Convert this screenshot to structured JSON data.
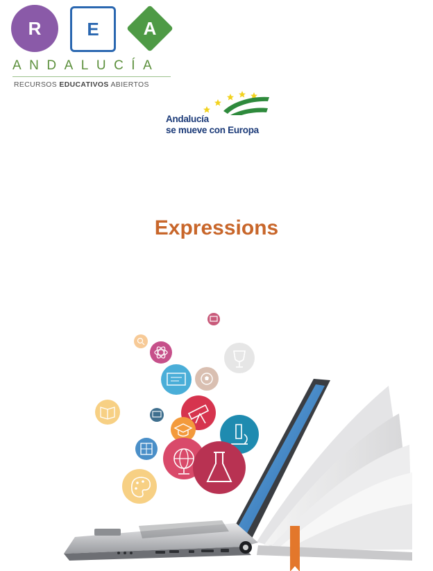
{
  "rea_logo": {
    "letters": [
      "R",
      "E",
      "A"
    ],
    "wordmark": "ANDALUCÍA",
    "subtitle_part1": "RECURSOS ",
    "subtitle_bold": "EDUCATIVOS",
    "subtitle_part2": " ABIERTOS",
    "colors": {
      "r": "#8a5aa8",
      "e": "#2a67b0",
      "a": "#4e9a45",
      "wordmark": "#5b8f3b"
    }
  },
  "eu_logo": {
    "line1": "Andalucía",
    "line2": "se mueve con Europa",
    "colors": {
      "text": "#1b3a78",
      "stripe": "#2e8a3c",
      "stars": "#f2d21e"
    }
  },
  "document": {
    "title": "Expressions",
    "title_color": "#c8662a"
  },
  "illustration": {
    "icons": [
      "presentation-icon",
      "search-icon",
      "atom-icon",
      "trophy-icon",
      "blackboard-icon",
      "football-icon",
      "book-icon",
      "monitor-icon",
      "telescope-icon",
      "graduation-cap-icon",
      "microscope-icon",
      "calculator-icon",
      "globe-icon",
      "flask-icon",
      "palette-icon"
    ]
  }
}
